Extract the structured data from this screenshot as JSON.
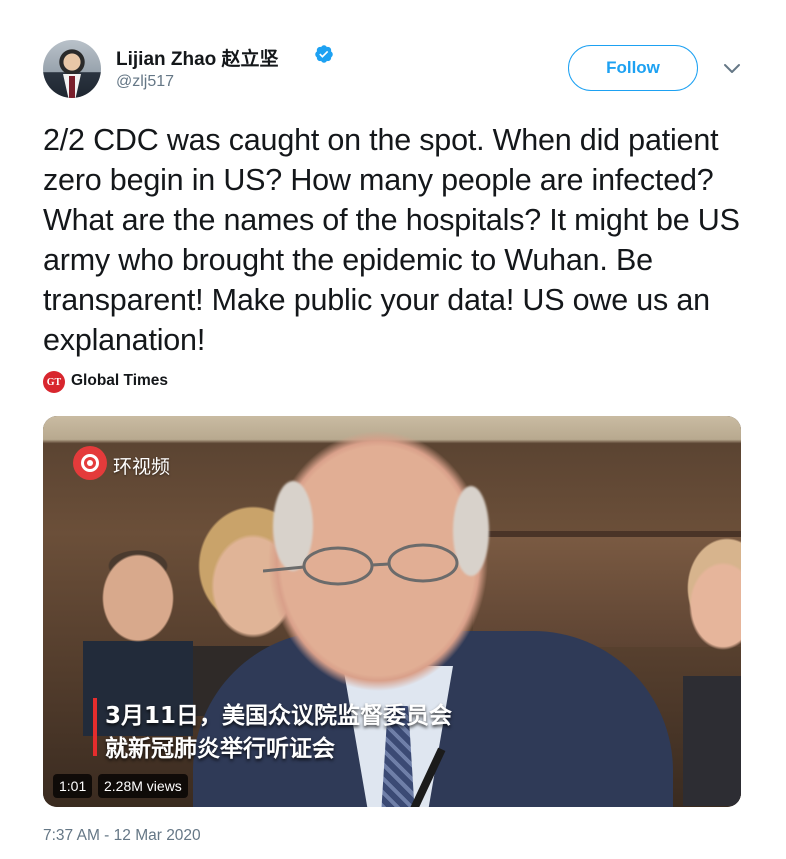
{
  "author": {
    "name": "Lijian Zhao 赵立坚",
    "handle": "@zlj517",
    "verified_icon": "verified-badge-icon",
    "avatar": "profile photo"
  },
  "actions": {
    "follow_label": "Follow",
    "menu_icon": "chevron-down-icon"
  },
  "tweet": {
    "text": "2/2 CDC was caught on the spot. When did patient zero begin in US? How many people are infected? What are the names of the hospitals? It might be US army who brought the epidemic to Wuhan. Be transparent! Make public your data! US owe us an explanation!",
    "source_name": "Global Times",
    "source_logo": "GT",
    "timestamp": "7:37 AM - 12 Mar 2020"
  },
  "video": {
    "channel": "环视频",
    "caption_line1": "3月11日，美国众议院监督委员会",
    "caption_line2": "就新冠肺炎举行听证会",
    "duration": "1:01",
    "views": "2.28M views"
  },
  "colors": {
    "accent": "#1da1f2",
    "muted": "#657786",
    "caption_bar": "#e52d2d"
  }
}
